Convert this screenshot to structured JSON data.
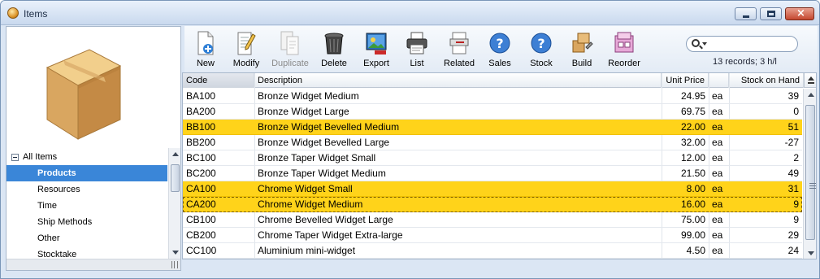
{
  "window": {
    "title": "Items"
  },
  "tree": {
    "root": "All Items",
    "items": [
      "Products",
      "Resources",
      "Time",
      "Ship Methods",
      "Other",
      "Stocktake"
    ],
    "selected": "Products"
  },
  "toolbar": {
    "buttons": [
      {
        "label": "New",
        "icon": "new-icon"
      },
      {
        "label": "Modify",
        "icon": "modify-icon"
      },
      {
        "label": "Duplicate",
        "icon": "duplicate-icon",
        "disabled": true
      },
      {
        "label": "Delete",
        "icon": "delete-icon"
      },
      {
        "label": "Export",
        "icon": "export-icon"
      },
      {
        "label": "List",
        "icon": "printer-icon"
      },
      {
        "label": "Related",
        "icon": "related-icon"
      },
      {
        "label": "Sales",
        "icon": "help-icon"
      },
      {
        "label": "Stock",
        "icon": "help-icon"
      },
      {
        "label": "Build",
        "icon": "build-icon"
      },
      {
        "label": "Reorder",
        "icon": "reorder-icon"
      }
    ],
    "search_value": "",
    "records_info": "13 records; 3 h/l"
  },
  "grid": {
    "columns": [
      "Code",
      "Description",
      "Unit Price",
      "",
      "Stock on Hand"
    ],
    "rows": [
      {
        "code": "BA100",
        "description": "Bronze Widget Medium",
        "price": "24.95",
        "unit": "ea",
        "stock": "39",
        "highlight": false
      },
      {
        "code": "BA200",
        "description": "Bronze Widget Large",
        "price": "69.75",
        "unit": "ea",
        "stock": "0",
        "highlight": false
      },
      {
        "code": "BB100",
        "description": "Bronze Widget Bevelled Medium",
        "price": "22.00",
        "unit": "ea",
        "stock": "51",
        "highlight": true
      },
      {
        "code": "BB200",
        "description": "Bronze Widget Bevelled Large",
        "price": "32.00",
        "unit": "ea",
        "stock": "-27",
        "highlight": false
      },
      {
        "code": "BC100",
        "description": "Bronze Taper Widget Small",
        "price": "12.00",
        "unit": "ea",
        "stock": "2",
        "highlight": false
      },
      {
        "code": "BC200",
        "description": "Bronze Taper Widget Medium",
        "price": "21.50",
        "unit": "ea",
        "stock": "49",
        "highlight": false
      },
      {
        "code": "CA100",
        "description": "Chrome Widget Small",
        "price": "8.00",
        "unit": "ea",
        "stock": "31",
        "highlight": true
      },
      {
        "code": "CA200",
        "description": "Chrome Widget Medium",
        "price": "16.00",
        "unit": "ea",
        "stock": "9",
        "highlight": true
      },
      {
        "code": "CB100",
        "description": "Chrome Bevelled Widget Large",
        "price": "75.00",
        "unit": "ea",
        "stock": "9",
        "highlight": false
      },
      {
        "code": "CB200",
        "description": "Chrome Taper Widget Extra-large",
        "price": "99.00",
        "unit": "ea",
        "stock": "29",
        "highlight": false
      },
      {
        "code": "CC100",
        "description": "Aluminium mini-widget",
        "price": "4.50",
        "unit": "ea",
        "stock": "24",
        "highlight": false
      }
    ]
  },
  "colors": {
    "highlight": "#ffd31a",
    "selection": "#3a86d8"
  }
}
